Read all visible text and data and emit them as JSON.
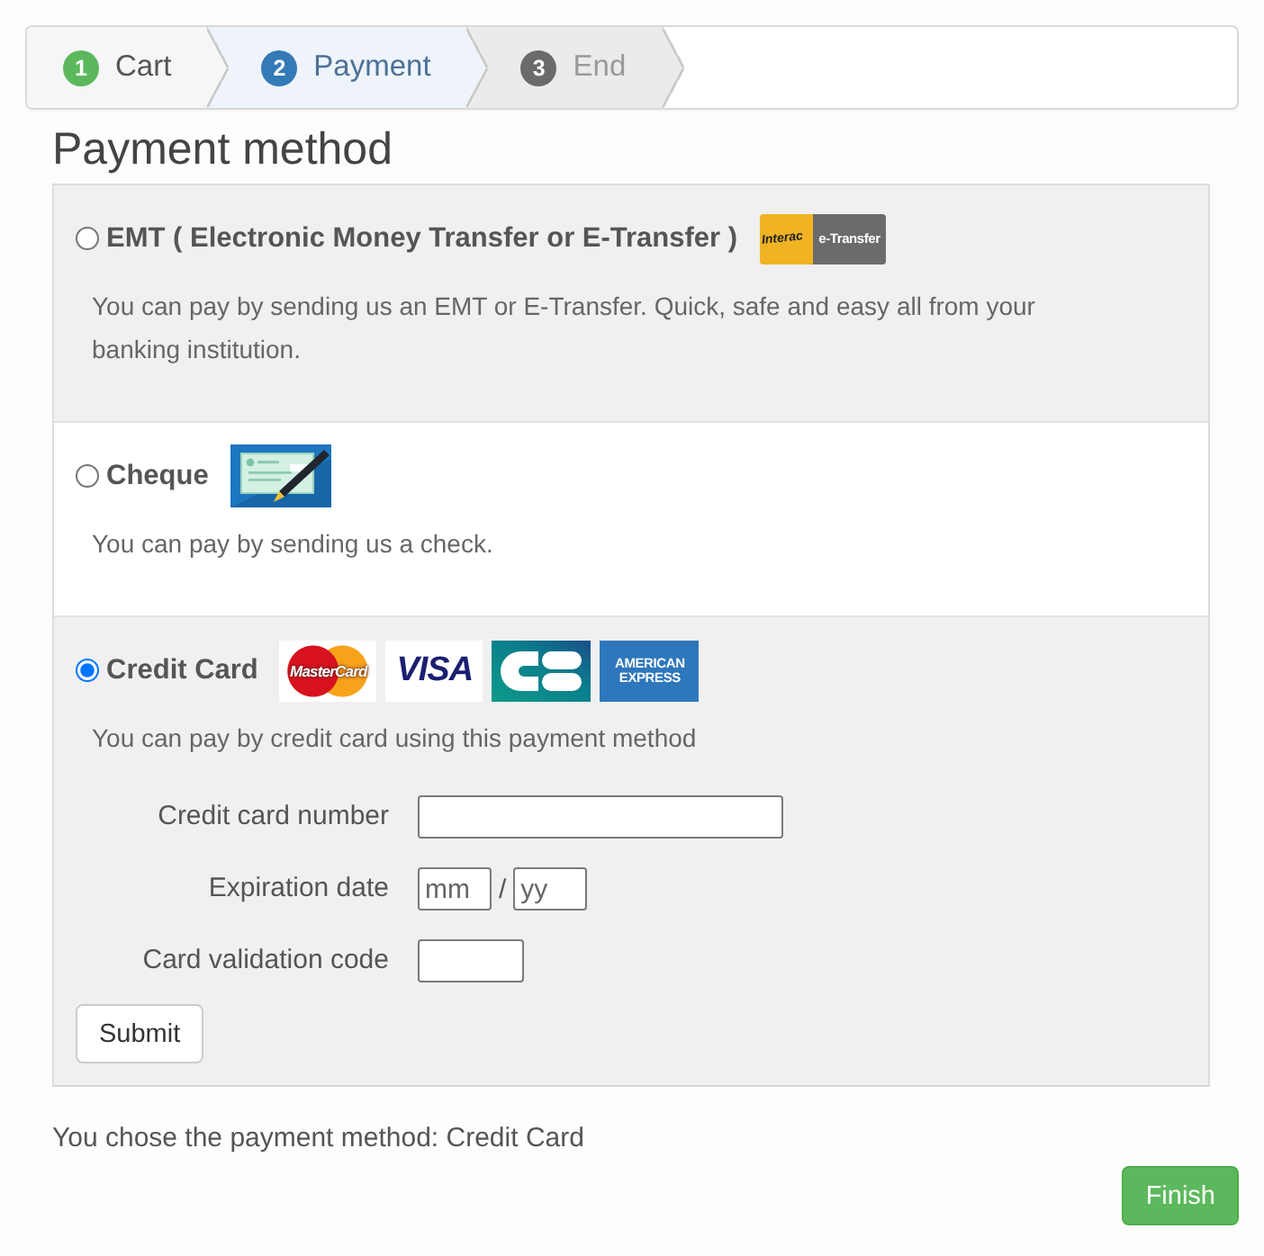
{
  "steps": [
    {
      "number": "1",
      "label": "Cart",
      "completed": true,
      "selected": false
    },
    {
      "number": "2",
      "label": "Payment",
      "completed": false,
      "selected": true
    },
    {
      "number": "3",
      "label": "End",
      "completed": false,
      "selected": false
    }
  ],
  "heading": "Payment method",
  "methods": [
    {
      "label": "EMT ( Electronic Money Transfer or E-Transfer )",
      "selected": false,
      "logos": [
        {
          "kind": "interac",
          "lines": [
            "Interac",
            "e-Transfer"
          ]
        }
      ],
      "description": "You can pay by sending us an EMT or E-Transfer. Quick, safe and easy all from your banking institution."
    },
    {
      "label": "Cheque",
      "selected": false,
      "logos": [
        {
          "kind": "cheque"
        }
      ],
      "description": "You can pay by sending us a check."
    },
    {
      "label": "Credit Card",
      "selected": true,
      "logos": [
        {
          "kind": "mastercard",
          "lines": [
            "MasterCard"
          ]
        },
        {
          "kind": "visa",
          "lines": [
            "VISA"
          ]
        },
        {
          "kind": "cb"
        },
        {
          "kind": "amex",
          "lines": [
            "AMERICAN",
            "EXPRESS"
          ]
        }
      ],
      "description": "You can pay by credit card using this payment method",
      "form": {
        "fields": [
          {
            "label": "Credit card number",
            "inputs": [
              {
                "kind": "card_number"
              }
            ]
          },
          {
            "label": "Expiration date",
            "separator": "/",
            "inputs": [
              {
                "kind": "month",
                "placeholder": "mm"
              },
              {
                "kind": "year",
                "placeholder": "yy"
              }
            ]
          },
          {
            "label": "Card validation code",
            "inputs": [
              {
                "kind": "cvc"
              }
            ]
          }
        ],
        "submit": "Submit"
      }
    }
  ],
  "status_text": "You chose the payment method: Credit Card",
  "finish": "Finish"
}
